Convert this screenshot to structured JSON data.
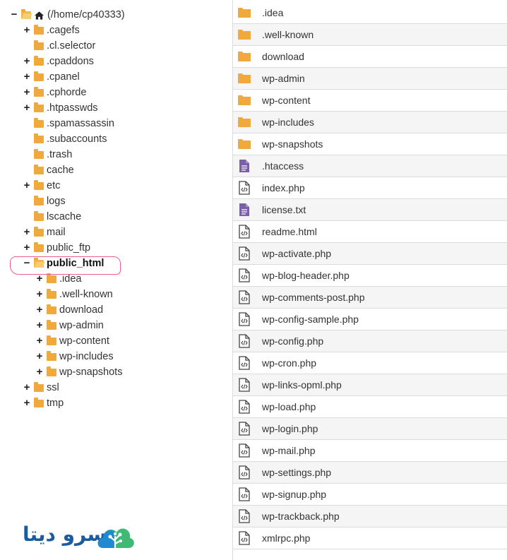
{
  "tree": {
    "root_label": "(/home/cp40333)",
    "items": [
      {
        "toggle": "+",
        "label": ".cagefs",
        "level": 1
      },
      {
        "toggle": "",
        "label": ".cl.selector",
        "level": 1
      },
      {
        "toggle": "+",
        "label": ".cpaddons",
        "level": 1
      },
      {
        "toggle": "+",
        "label": ".cpanel",
        "level": 1
      },
      {
        "toggle": "+",
        "label": ".cphorde",
        "level": 1
      },
      {
        "toggle": "+",
        "label": ".htpasswds",
        "level": 1
      },
      {
        "toggle": "",
        "label": ".spamassassin",
        "level": 1
      },
      {
        "toggle": "",
        "label": ".subaccounts",
        "level": 1
      },
      {
        "toggle": "",
        "label": ".trash",
        "level": 1
      },
      {
        "toggle": "",
        "label": "cache",
        "level": 1
      },
      {
        "toggle": "+",
        "label": "etc",
        "level": 1
      },
      {
        "toggle": "",
        "label": "logs",
        "level": 1
      },
      {
        "toggle": "",
        "label": "lscache",
        "level": 1
      },
      {
        "toggle": "+",
        "label": "mail",
        "level": 1
      },
      {
        "toggle": "+",
        "label": "public_ftp",
        "level": 1
      },
      {
        "toggle": "−",
        "label": "public_html",
        "level": 1,
        "open": true,
        "selected": true
      },
      {
        "toggle": "+",
        "label": ".idea",
        "level": 2
      },
      {
        "toggle": "+",
        "label": ".well-known",
        "level": 2
      },
      {
        "toggle": "+",
        "label": "download",
        "level": 2
      },
      {
        "toggle": "+",
        "label": "wp-admin",
        "level": 2
      },
      {
        "toggle": "+",
        "label": "wp-content",
        "level": 2
      },
      {
        "toggle": "+",
        "label": "wp-includes",
        "level": 2
      },
      {
        "toggle": "+",
        "label": "wp-snapshots",
        "level": 2
      },
      {
        "toggle": "+",
        "label": "ssl",
        "level": 1
      },
      {
        "toggle": "+",
        "label": "tmp",
        "level": 1
      }
    ]
  },
  "files": [
    {
      "name": ".idea",
      "icon": "folder-icon"
    },
    {
      "name": ".well-known",
      "icon": "folder-icon"
    },
    {
      "name": "download",
      "icon": "folder-icon"
    },
    {
      "name": "wp-admin",
      "icon": "folder-icon"
    },
    {
      "name": "wp-content",
      "icon": "folder-icon"
    },
    {
      "name": "wp-includes",
      "icon": "folder-icon"
    },
    {
      "name": "wp-snapshots",
      "icon": "folder-icon"
    },
    {
      "name": ".htaccess",
      "icon": "text-file-icon"
    },
    {
      "name": "index.php",
      "icon": "code-file-icon"
    },
    {
      "name": "license.txt",
      "icon": "text-file-icon"
    },
    {
      "name": "readme.html",
      "icon": "code-file-icon"
    },
    {
      "name": "wp-activate.php",
      "icon": "code-file-icon"
    },
    {
      "name": "wp-blog-header.php",
      "icon": "code-file-icon"
    },
    {
      "name": "wp-comments-post.php",
      "icon": "code-file-icon"
    },
    {
      "name": "wp-config-sample.php",
      "icon": "code-file-icon"
    },
    {
      "name": "wp-config.php",
      "icon": "code-file-icon"
    },
    {
      "name": "wp-cron.php",
      "icon": "code-file-icon"
    },
    {
      "name": "wp-links-opml.php",
      "icon": "code-file-icon"
    },
    {
      "name": "wp-load.php",
      "icon": "code-file-icon"
    },
    {
      "name": "wp-login.php",
      "icon": "code-file-icon"
    },
    {
      "name": "wp-mail.php",
      "icon": "code-file-icon"
    },
    {
      "name": "wp-settings.php",
      "icon": "code-file-icon"
    },
    {
      "name": "wp-signup.php",
      "icon": "code-file-icon"
    },
    {
      "name": "wp-trackback.php",
      "icon": "code-file-icon"
    },
    {
      "name": "xmlrpc.php",
      "icon": "code-file-icon"
    }
  ],
  "logo": {
    "text": "سرو دیتا"
  },
  "colors": {
    "folder": "#efa93c",
    "text_file": "#7b5fa6",
    "highlight": "#e8608e",
    "logo_blue": "#1b5b9e",
    "logo_green": "#3dba74"
  }
}
